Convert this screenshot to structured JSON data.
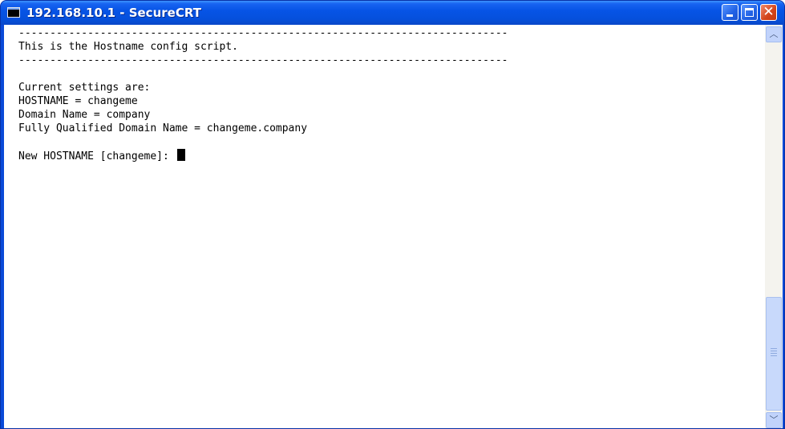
{
  "window": {
    "title": "192.168.10.1 - SecureCRT",
    "icon": "terminal-icon",
    "controls": {
      "minimize_icon": "minimize-icon",
      "maximize_icon": "maximize-icon",
      "close_icon": "close-icon",
      "close_glyph": "✕"
    }
  },
  "terminal": {
    "lines": [
      "------------------------------------------------------------------------------",
      "This is the Hostname config script.",
      "------------------------------------------------------------------------------",
      "",
      "Current settings are:",
      "HOSTNAME = changeme",
      "Domain Name = company",
      "Fully Qualified Domain Name = changeme.company",
      "",
      "New HOSTNAME [changeme]: "
    ]
  },
  "scrollbar": {
    "up_glyph": "︿",
    "down_glyph": "﹀"
  },
  "colors": {
    "titlebar": "#0754e6",
    "close_button": "#d2441a",
    "terminal_bg": "#ffffff",
    "terminal_fg": "#000000"
  }
}
